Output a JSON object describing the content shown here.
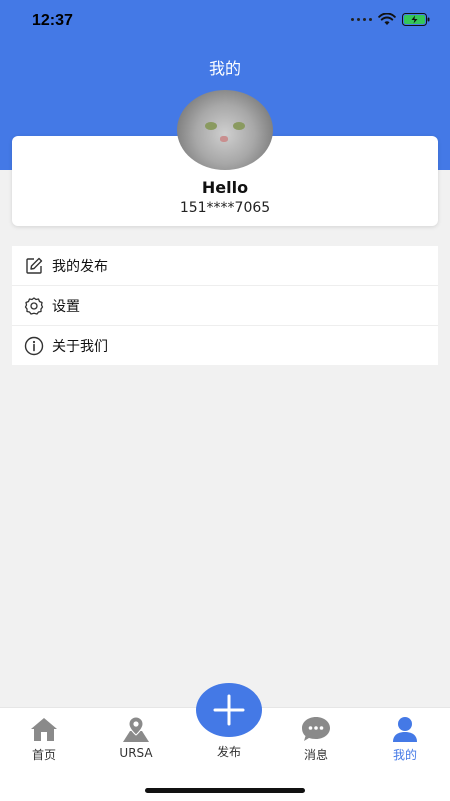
{
  "status_bar": {
    "time": "12:37"
  },
  "header": {
    "title": "我的"
  },
  "profile": {
    "name": "Hello",
    "phone": "151****7065"
  },
  "menu": [
    {
      "label": "我的发布",
      "icon": "edit-icon"
    },
    {
      "label": "设置",
      "icon": "gear-icon"
    },
    {
      "label": "关于我们",
      "icon": "info-icon"
    }
  ],
  "tabs": [
    {
      "label": "首页",
      "icon": "home-icon",
      "active": false
    },
    {
      "label": "URSA",
      "icon": "map-pin-icon",
      "active": false
    },
    {
      "label": "发布",
      "icon": "plus-icon",
      "active": false
    },
    {
      "label": "消息",
      "icon": "chat-icon",
      "active": false
    },
    {
      "label": "我的",
      "icon": "user-icon",
      "active": true
    }
  ],
  "colors": {
    "accent": "#4479e6",
    "background": "#f1f1f1"
  }
}
